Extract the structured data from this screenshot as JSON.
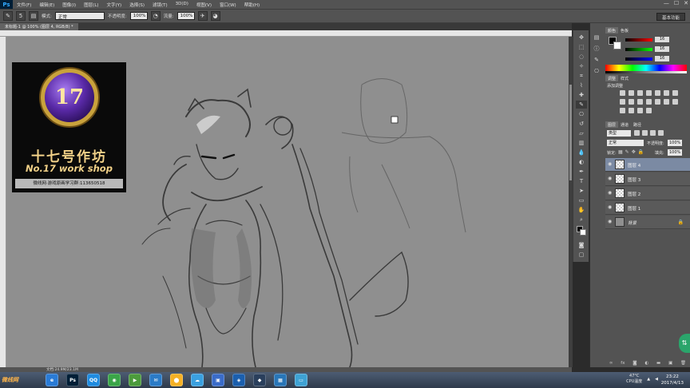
{
  "app": {
    "logo": "Ps",
    "menu": [
      "文件(F)",
      "编辑(E)",
      "图像(I)",
      "图层(L)",
      "文字(Y)",
      "选择(S)",
      "滤镜(T)",
      "3D(D)",
      "视图(V)",
      "窗口(W)",
      "帮助(H)"
    ],
    "window_controls": [
      "—",
      "☐",
      "✕"
    ]
  },
  "options": {
    "brush_size": "5",
    "mode_label": "模式:",
    "mode_value": "正常",
    "opacity_label": "不透明度:",
    "opacity_value": "100%",
    "flow_label": "流量:",
    "flow_value": "100%",
    "workspace": "基本功能"
  },
  "document": {
    "tab_title": "未标题-1 @ 100% (图层 4, RGB/8) *",
    "status": "文档:24.9M/23.1M"
  },
  "logo_overlay": {
    "badge_number": "17",
    "title_cn": "十七号作坊",
    "title_en": "No.17 work shop",
    "caption": "微线网·游戏原画学习群:113650518"
  },
  "panels": {
    "color_tabs": [
      "颜色",
      "色板"
    ],
    "rgb_values": [
      "16",
      "16",
      "16"
    ],
    "adjust_tabs": [
      "调整",
      "样式"
    ],
    "adjust_add_label": "添加调整",
    "layers_tabs": [
      "图层",
      "通道",
      "路径"
    ],
    "kind_label": "类型",
    "blend_mode": "正常",
    "opacity_label": "不透明度:",
    "opacity_value": "100%",
    "lock_label": "锁定:",
    "fill_label": "填充:",
    "fill_value": "100%",
    "layers": [
      {
        "name": "图层 4",
        "selected": true
      },
      {
        "name": "图层 3",
        "selected": false
      },
      {
        "name": "图层 2",
        "selected": false
      },
      {
        "name": "图层 1",
        "selected": false
      },
      {
        "name": "背景",
        "selected": false
      }
    ]
  },
  "taskbar": {
    "start_label": "微线网",
    "icons": [
      {
        "label": "e",
        "color": "#2a7bd6"
      },
      {
        "label": "Ps",
        "color": "#001e36"
      },
      {
        "label": "QQ",
        "color": "#1f8be0"
      },
      {
        "label": "◉",
        "color": "#3aa548"
      },
      {
        "label": "▶",
        "color": "#4c9b3c"
      },
      {
        "label": "✉",
        "color": "#2b7bc7"
      },
      {
        "label": "⬤",
        "color": "#f5b024"
      },
      {
        "label": "☁",
        "color": "#3aa0e0"
      },
      {
        "label": "▣",
        "color": "#3a6cc9"
      },
      {
        "label": "◈",
        "color": "#1b5fae"
      },
      {
        "label": "◆",
        "color": "#2a3f5c"
      },
      {
        "label": "▦",
        "color": "#2976b8"
      },
      {
        "label": "▭",
        "color": "#3ea2d4"
      }
    ],
    "temp": "47°C",
    "cpu_label": "CPU温度",
    "time": "23:22",
    "date": "2017/4/13"
  }
}
